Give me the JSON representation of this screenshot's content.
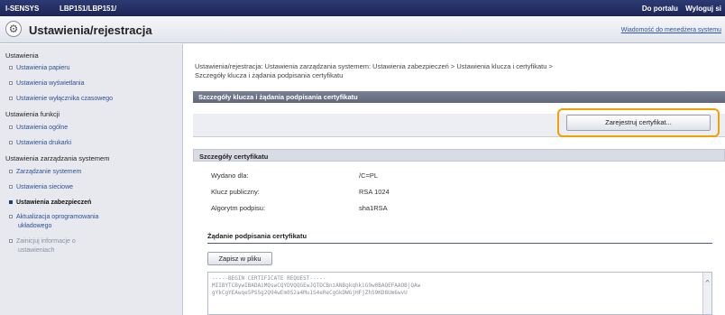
{
  "topbar": {
    "brand": "I-SENSYS",
    "model": "LBP151/LBP151/",
    "portal_link": "Do portalu",
    "logout_link": "Wyloguj si"
  },
  "header": {
    "title": "Ustawienia/rejestracja",
    "message_link": "Wiadomość do menedżera systemu"
  },
  "sidebar": {
    "cat1": "Ustawienia",
    "cat1_items": [
      "Ustawienia papieru",
      "Ustawienia wyświetlania",
      "Ustawienie wyłącznika czasowego"
    ],
    "cat2": "Ustawienia funkcji",
    "cat2_items": [
      "Ustawienia ogólne",
      "Ustawienia drukarki"
    ],
    "cat3": "Ustawienia zarządzania systemem",
    "cat3_items": [
      "Zarządzanie systemem",
      "Ustawienia sieciowe",
      "Ustawienia zabezpieczeń"
    ],
    "cat3_more_1": "Aktualizacja oprogramowania",
    "cat3_more_1b": "układowego",
    "cat3_more_2": "Zainicjuj informacje o",
    "cat3_more_2b": "ustawieniach"
  },
  "main": {
    "breadcrumb_1": "Ustawienia/rejestracja: Ustawienia zarządzania systemem: Ustawienia zabezpieczeń > Ustawienia klucza i certyfikatu >",
    "breadcrumb_2": "Szczegóły klucza i żądania podpisania certyfikatu",
    "panel_title": "Szczegóły klucza i żądania podpisania certyfikatu",
    "register_button": "Zarejestruj certyfikat...",
    "details_title": "Szczegóły certyfikatu",
    "rows": [
      {
        "label": "Wydano dla:",
        "value": "/C=PL"
      },
      {
        "label": "Klucz publiczny:",
        "value": "RSA 1024"
      },
      {
        "label": "Algorytm podpisu:",
        "value": "sha1RSA"
      }
    ],
    "request_title": "Żądanie podpisania certyfikatu",
    "save_button": "Zapisz w pliku",
    "cert_lines": [
      "-----BEGIN CERTIFICATE REQUEST-----",
      "MIIBYTCBywIBADAiMQswCQYDVQQGEwJQTDCBnzANBgkqhkiG9w0BAQEFAAOBjQAw",
      "gYkCgYEAwqe5PS5g2Q94wEm0S2a4Mu1S4eReCgGkDWGjHFjZhS9KD8Um6wvU"
    ]
  },
  "colors": {
    "topbar": "#1c2556",
    "accent": "#f0a000",
    "panel_header": "#5f6679"
  }
}
